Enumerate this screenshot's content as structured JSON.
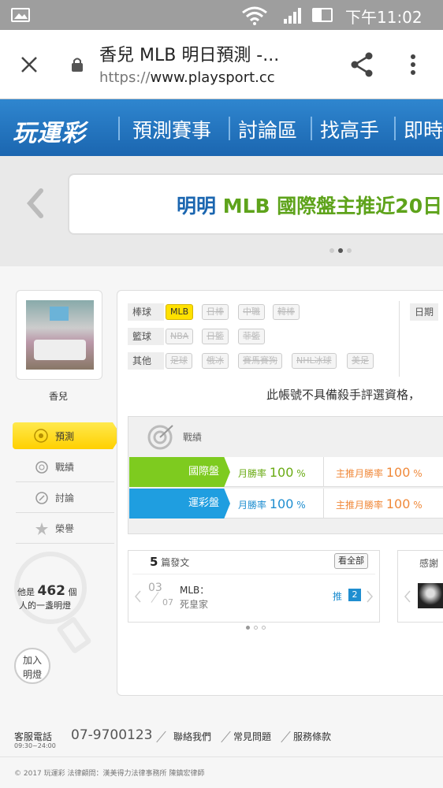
{
  "status": {
    "time": "下午11:02"
  },
  "browser": {
    "title": "香兒 MLB 明日預測 -...",
    "url_scheme": "https://",
    "url_host": "www.playsport.cc"
  },
  "nav": {
    "logo": "玩運彩",
    "items": [
      "預測賽事",
      "討論區",
      "找高手",
      "即時"
    ]
  },
  "banner": {
    "text_name": "明明",
    "text_league": "MLB 國際盤主推近20日"
  },
  "profile": {
    "name": "香兒"
  },
  "menu": {
    "items": [
      "預測",
      "戰績",
      "討論",
      "榮譽"
    ]
  },
  "lamp": {
    "prefix": "他是",
    "count": "462",
    "suffix": "個",
    "line2": "人的一盞明燈",
    "button": "加入明燈"
  },
  "categories": [
    {
      "label": "棒球",
      "tags": [
        "MLB",
        "日棒",
        "中職",
        "韓棒"
      ]
    },
    {
      "label": "籃球",
      "tags": [
        "NBA",
        "日籃",
        "菲籃"
      ]
    },
    {
      "label": "其他",
      "tags": [
        "足球",
        "俄冰",
        "賽馬賽狗",
        "NHL冰球",
        "美足"
      ]
    }
  ],
  "date_label": "日期",
  "notice": "此帳號不具備殺手評選資格，",
  "record": {
    "title": "戰績",
    "rows": [
      {
        "name": "國際盤",
        "month_label": "月勝率",
        "month_val": "100",
        "pct": "%",
        "main_label": "主推月勝率",
        "main_val": "100",
        "color": "#7ecb1f"
      },
      {
        "name": "運彩盤",
        "month_label": "月勝率",
        "month_val": "100",
        "pct": "%",
        "main_label": "主推月勝率",
        "main_val": "100",
        "color": "#1f9ee0"
      }
    ]
  },
  "posts": {
    "count": "5",
    "label": "篇發文",
    "view_all": "看全部",
    "item": {
      "day": "03",
      "month": "07",
      "title": "MLB：",
      "subtitle": "死皇家",
      "push_label": "推",
      "push_count": "2"
    }
  },
  "thanks": {
    "label": "感謝"
  },
  "footer": {
    "service_label": "客服電話",
    "hours": "09:30~24:00",
    "phone": "07-9700123",
    "links": [
      "聯絡我們",
      "常見問題",
      "服務條款"
    ],
    "copyright": "© 2017 玩運彩 法律顧問：漢美得力法律事務所 陳鎮宏律師"
  }
}
